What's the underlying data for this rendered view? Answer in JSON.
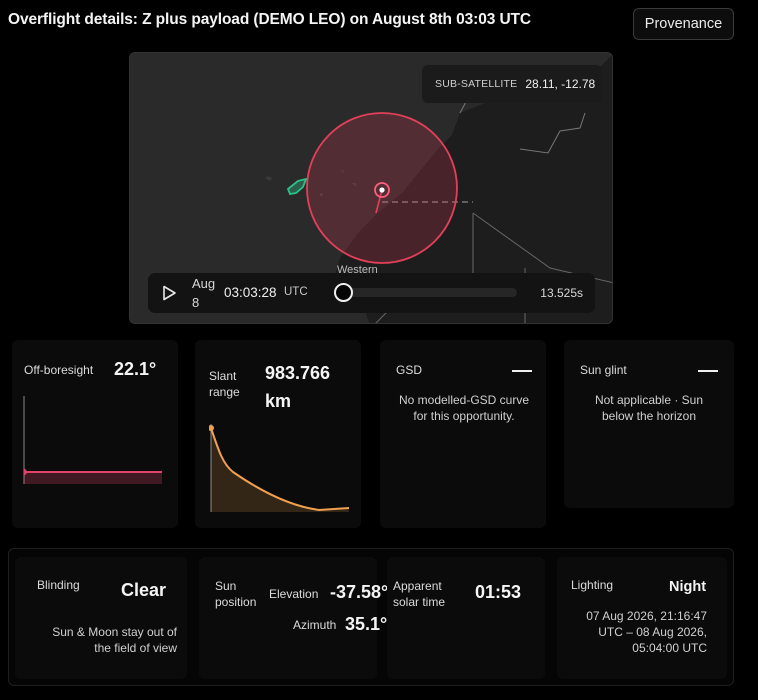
{
  "header": {
    "title": "Overflight details: Z plus payload (DEMO LEO) on August 8th 03:03 UTC",
    "provenance_label": "Provenance"
  },
  "map": {
    "subsat_label": "SUB-SATELLITE",
    "subsat_value": "28.11, -12.78",
    "region_label": "Western",
    "colors": {
      "footprint": "#e2405a",
      "island": "#2ec08a",
      "land": "#1e1e1e",
      "sea": "#2a2a2a"
    }
  },
  "player": {
    "date_label": "Aug 8",
    "time": "03:03:28",
    "tz": "UTC",
    "duration": "13.525s",
    "progress": 0.0
  },
  "cards": {
    "off_boresight": {
      "label": "Off-boresight",
      "value": "22.1°"
    },
    "slant_range": {
      "label": "Slant range",
      "value": "983.766 km"
    },
    "gsd": {
      "label": "GSD",
      "note": "No modelled-GSD curve for this opportunity."
    },
    "sun_glint": {
      "label": "Sun glint",
      "note": "Not applicable · Sun below the horizon"
    },
    "blinding": {
      "label": "Blinding",
      "value": "Clear",
      "note": "Sun & Moon stay out of the field of view"
    },
    "sun_position": {
      "label": "Sun position",
      "elevation_label": "Elevation",
      "elevation_value": "-37.58°",
      "azimuth_label": "Azimuth",
      "azimuth_value": "35.1°"
    },
    "apparent_solar_time": {
      "label": "Apparent solar time",
      "value": "01:53"
    },
    "lighting": {
      "label": "Lighting",
      "value": "Night",
      "note": "07 Aug 2026, 21:16:47 UTC – 08 Aug 2026, 05:04:00 UTC"
    }
  },
  "colors": {
    "accent_pink": "#e0436a",
    "accent_orange": "#f0a050"
  }
}
